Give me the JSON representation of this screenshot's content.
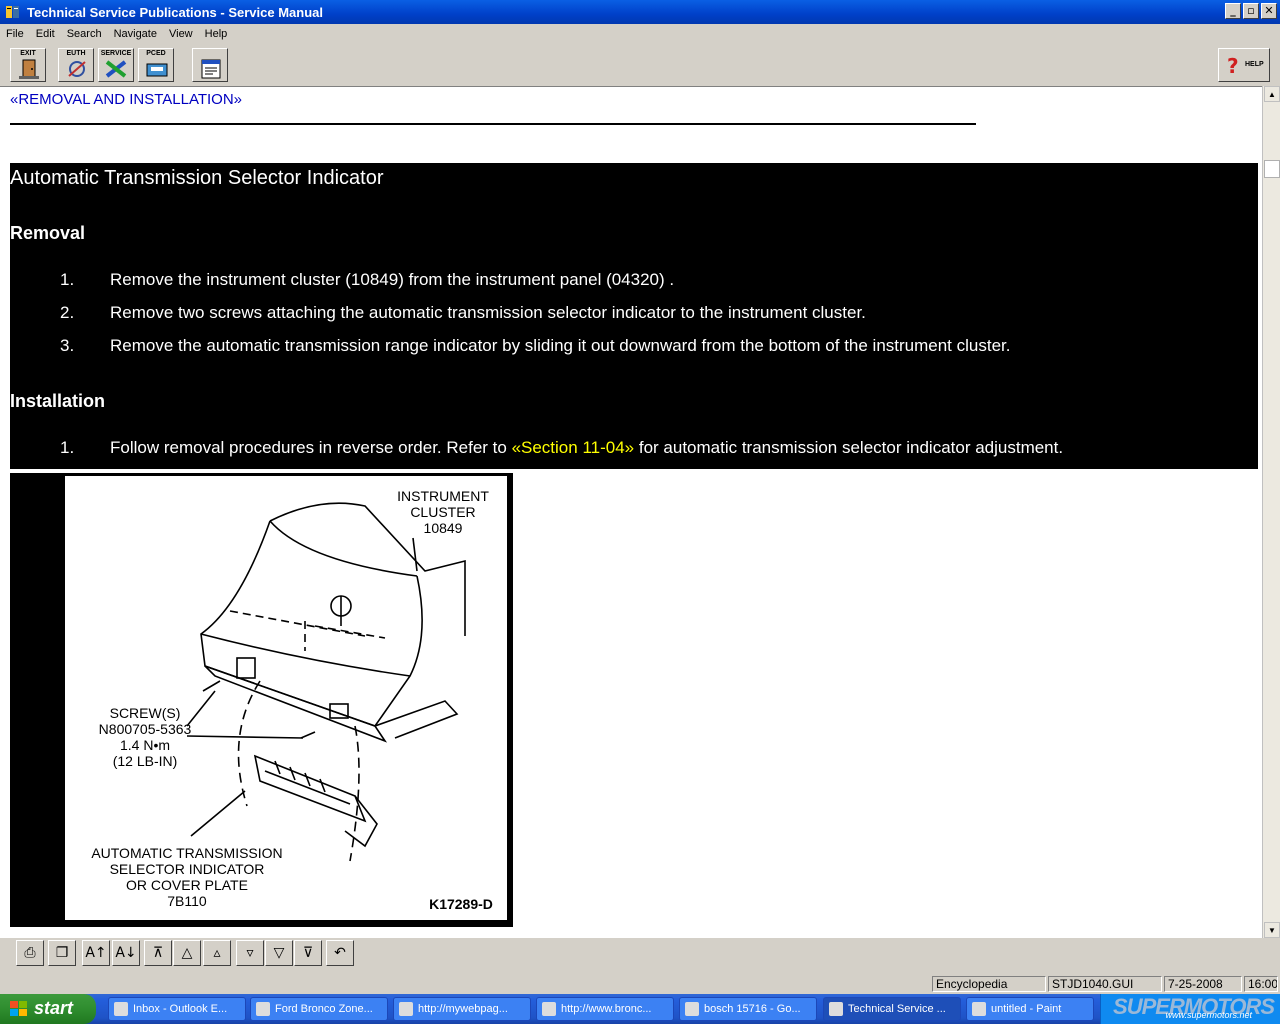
{
  "window": {
    "title": "Technical Service Publications - Service Manual",
    "controls": [
      "_",
      "▫",
      "✕"
    ]
  },
  "menu": [
    "File",
    "Edit",
    "Search",
    "Navigate",
    "View",
    "Help"
  ],
  "toolbar": {
    "buttons": [
      "EXIT",
      "EUTH",
      "SERVICE",
      "PCED",
      ""
    ],
    "help_label": "HELP"
  },
  "content": {
    "top_link": "«REMOVAL AND INSTALLATION»",
    "heading": "Automatic Transmission Selector Indicator",
    "removal_heading": "Removal",
    "removal_steps": [
      {
        "num": "1.",
        "text": "Remove the instrument cluster (10849) from the instrument panel (04320) ."
      },
      {
        "num": "2.",
        "text": "Remove two screws attaching the automatic transmission selector indicator to the instrument cluster."
      },
      {
        "num": "3.",
        "text": "Remove the automatic transmission range indicator by sliding it out downward from the bottom of the instrument cluster."
      }
    ],
    "installation_heading": "Installation",
    "installation_step": {
      "num": "1.",
      "before": "Follow removal procedures in reverse order. Refer to ",
      "link": "«Section 11-04»",
      "after": " for automatic transmission selector indicator adjustment."
    }
  },
  "figure": {
    "label_cluster": [
      "INSTRUMENT",
      "CLUSTER",
      "10849"
    ],
    "label_screws": [
      "SCREW(S)",
      "N800705-5363",
      "1.4 N•m",
      "(12 LB-IN)"
    ],
    "label_indicator": [
      "AUTOMATIC TRANSMISSION",
      "SELECTOR INDICATOR",
      "OR COVER PLATE",
      "7B110"
    ],
    "figure_id": "K17289-D"
  },
  "statusbar": {
    "mode": "Encyclopedia",
    "doc": "STJD1040.GUI",
    "date": "7-25-2008",
    "time": "16:00"
  },
  "taskbar": {
    "start": "start",
    "tasks": [
      "Inbox - Outlook E...",
      "Ford Bronco Zone...",
      "http://mywebpag...",
      "http://www.bronc...",
      "bosch 15716 - Go...",
      "Technical Service ...",
      "untitled - Paint"
    ],
    "watermark": "SUPERMOTORS",
    "watermark_url": "www.supermotors.net"
  }
}
